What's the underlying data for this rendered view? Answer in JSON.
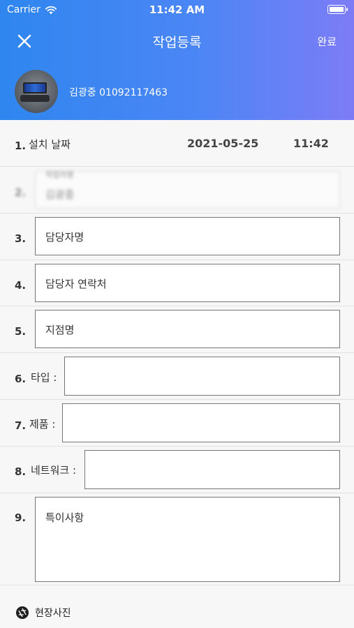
{
  "status": {
    "carrier": "Carrier",
    "time": "11:42 AM"
  },
  "nav": {
    "title": "작업등록",
    "done": "완료"
  },
  "user": {
    "info": "김광중 01092117463"
  },
  "rows": {
    "r1": {
      "num": "1.",
      "label": "설치 날짜",
      "date": "2021-05-25",
      "time": "11:42"
    },
    "r2": {
      "num": "2.",
      "label": "작업자명",
      "value": "김광중"
    },
    "r3": {
      "num": "3.",
      "placeholder": "담당자명"
    },
    "r4": {
      "num": "4.",
      "placeholder": "담당자 연락처"
    },
    "r5": {
      "num": "5.",
      "placeholder": "지점명"
    },
    "r6": {
      "num": "6.",
      "label": "타입 :"
    },
    "r7": {
      "num": "7.",
      "label": "제품 :"
    },
    "r8": {
      "num": "8.",
      "label": "네트워크 :"
    },
    "r9": {
      "num": "9.",
      "placeholder": "특이사항"
    }
  },
  "footer": {
    "photo": "현장사진"
  }
}
